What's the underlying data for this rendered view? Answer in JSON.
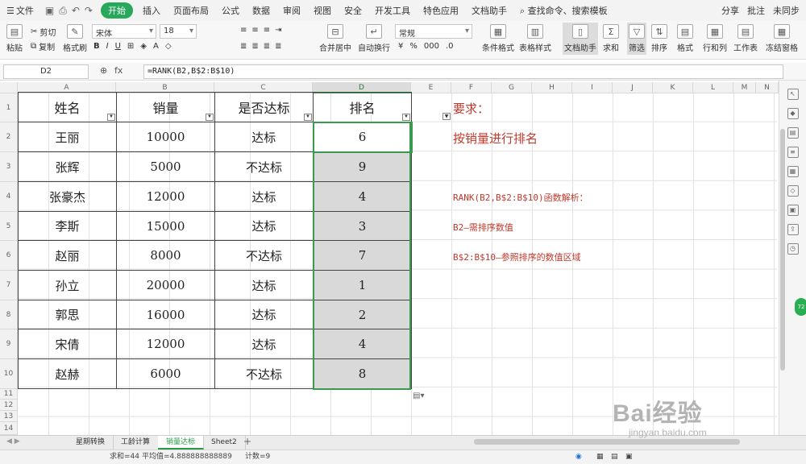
{
  "menubar": {
    "file": "文件",
    "items": [
      "开始",
      "插入",
      "页面布局",
      "公式",
      "数据",
      "审阅",
      "视图",
      "安全",
      "开发工具",
      "特色应用",
      "文档助手"
    ],
    "active_index": 0,
    "search": "查找命令、搜索模板",
    "right": [
      "分享",
      "批注",
      "未同步"
    ]
  },
  "ribbon": {
    "paste": "粘贴",
    "cut": "剪切",
    "copy": "复制",
    "format_painter": "格式刷",
    "font_name": "宋体",
    "font_size": "18",
    "bold": "B",
    "italic": "I",
    "underline": "U",
    "merge": "合并居中",
    "wrap": "自动换行",
    "number_format": "常规",
    "percent": "%",
    "cond_format": "条件格式",
    "table_style": "表格样式",
    "doc_helper": "文档助手",
    "sum": "求和",
    "filter": "筛选",
    "sort": "排序",
    "format": "格式",
    "rowcol": "行和列",
    "worksheet": "工作表",
    "freeze": "冻结窗格"
  },
  "formula_bar": {
    "cell_ref": "D2",
    "fx": "fx",
    "formula": "=RANK(B2,B$2:B$10)"
  },
  "columns": [
    "A",
    "B",
    "C",
    "D",
    "E",
    "F",
    "G",
    "H",
    "I",
    "J",
    "K",
    "L",
    "M",
    "N"
  ],
  "rows": [
    "1",
    "2",
    "3",
    "4",
    "5",
    "6",
    "7",
    "8",
    "9",
    "10",
    "11",
    "12",
    "13",
    "14"
  ],
  "table": {
    "headers": [
      "姓名",
      "销量",
      "是否达标",
      "排名"
    ],
    "rows": [
      [
        "王丽",
        "10000",
        "达标",
        "6"
      ],
      [
        "张辉",
        "5000",
        "不达标",
        "9"
      ],
      [
        "张豪杰",
        "12000",
        "达标",
        "4"
      ],
      [
        "李斯",
        "15000",
        "达标",
        "3"
      ],
      [
        "赵丽",
        "8000",
        "不达标",
        "7"
      ],
      [
        "孙立",
        "20000",
        "达标",
        "1"
      ],
      [
        "郭思",
        "16000",
        "达标",
        "2"
      ],
      [
        "宋倩",
        "12000",
        "达标",
        "4"
      ],
      [
        "赵赫",
        "6000",
        "不达标",
        "8"
      ]
    ]
  },
  "notes": {
    "requirement": "要求：",
    "task": "按销量进行排名",
    "explain_title": "RANK(B2,B$2:B$10)函数解析：",
    "explain_b2": "B2—需排序数值",
    "explain_range": "B$2:B$10—参照排序的数值区域"
  },
  "sheets": [
    "星期转换",
    "工龄计算",
    "销量达标",
    "Sheet2"
  ],
  "active_sheet": 2,
  "status": {
    "sum": "求和=44",
    "avg": "平均值=4.888888888889",
    "count": "计数=9"
  },
  "watermark": {
    "brand": "Bai经验",
    "url": "jingyan.baidu.com"
  },
  "colors": {
    "accent": "#27a85a",
    "note": "#c0392b",
    "rank_fill": "#d9d9d9"
  }
}
